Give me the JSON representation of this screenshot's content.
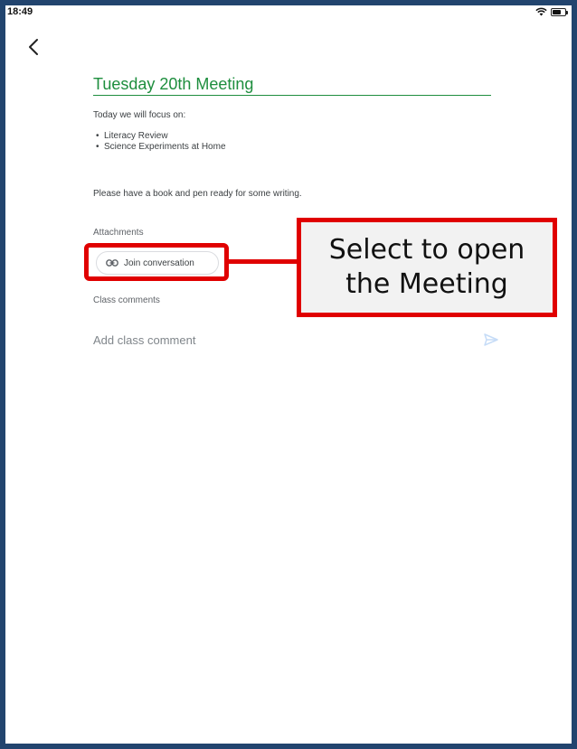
{
  "status_bar": {
    "time": "18:49",
    "icons": [
      "wifi-icon",
      "battery-icon"
    ]
  },
  "navigation": {
    "back_icon": "chevron-left-icon"
  },
  "post": {
    "title": "Tuesday 20th Meeting",
    "intro": "Today we will focus on:",
    "bullets": [
      "Literacy Review",
      "Science Experiments at Home"
    ],
    "reminder": "Please have a book and pen ready for some writing."
  },
  "attachments": {
    "label": "Attachments",
    "items": [
      {
        "label": "Join conversation",
        "icon": "link-icon"
      }
    ]
  },
  "comments": {
    "label": "Class comments",
    "placeholder": "Add class comment",
    "send_icon": "send-icon"
  },
  "annotation": {
    "callout_lines": [
      "Select to open",
      "the Meeting"
    ],
    "color": "#e00000"
  },
  "colors": {
    "accent": "#1e8e3e",
    "frame": "#22446e",
    "text": "#3c4043",
    "muted": "#5f6368"
  }
}
